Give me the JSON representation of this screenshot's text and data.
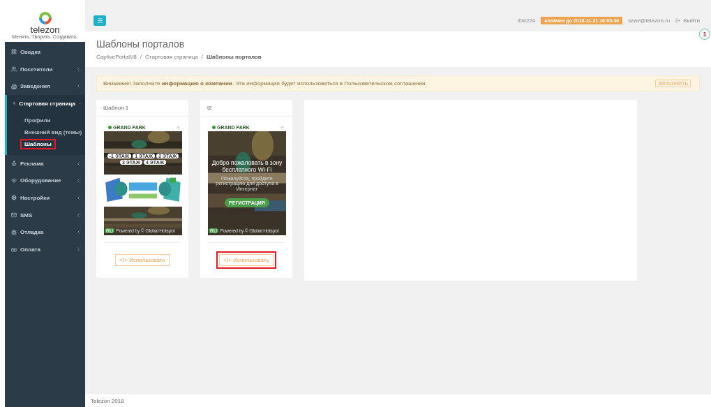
{
  "logo": {
    "name": "telezon",
    "tagline": "Менять. Творить. Создавать."
  },
  "topbar": {
    "account_id": "ID#224",
    "paid_until": "оплачен до 2018-11-21 16:05:46",
    "email": "seav@telezon.ru",
    "logout": "Выйти",
    "notification_count": "1"
  },
  "sidebar": {
    "items": [
      {
        "label": "Сводка",
        "has_arrow": false,
        "expanded": false
      },
      {
        "label": "Посетители",
        "has_arrow": true,
        "expanded": false
      },
      {
        "label": "Заведения",
        "has_arrow": true,
        "expanded": false
      },
      {
        "label": "Стартовая страница",
        "has_arrow": true,
        "expanded": true,
        "children": [
          {
            "label": "Профили",
            "selected": false,
            "highlighted": false
          },
          {
            "label": "Внешний вид (темы)",
            "selected": false,
            "highlighted": false
          },
          {
            "label": "Шаблоны",
            "selected": true,
            "highlighted": true
          }
        ]
      },
      {
        "label": "Реклама",
        "has_arrow": true,
        "expanded": false
      },
      {
        "label": "Оборудование",
        "has_arrow": true,
        "expanded": false
      },
      {
        "label": "Настройки",
        "has_arrow": true,
        "expanded": false
      },
      {
        "label": "SMS",
        "has_arrow": true,
        "expanded": false
      },
      {
        "label": "Отладка",
        "has_arrow": true,
        "expanded": false
      },
      {
        "label": "Оплата",
        "has_arrow": true,
        "expanded": false
      }
    ]
  },
  "page": {
    "title": "Шаблоны порталов",
    "breadcrumb_separators": [
      "/",
      "/"
    ],
    "breadcrumbs": [
      {
        "label": "CaptivePortalV8",
        "current": false
      },
      {
        "label": "Стартовая страница",
        "current": false
      },
      {
        "label": "Шаблоны порталов",
        "current": true
      }
    ]
  },
  "alert": {
    "text": "Внимание! Заполните **информацию о компании**. Эта информация будет использоваться в Пользовательском соглашении.",
    "button": "ЗАПОЛНИТЬ"
  },
  "templates": [
    {
      "title": "Шаблон 1",
      "kind": "map",
      "preview": {
        "logo": "GRAND PARK",
        "floors": [
          "-1 ЭТАЖ",
          "1 ЭТАЖ",
          "2 ЭТАЖ",
          "3 ЭТАЖ",
          "4 ЭТАЖ"
        ],
        "language": "RU",
        "powered": "Powered by © Global Hotspot"
      },
      "button": "</> Использовать",
      "highlighted": false
    },
    {
      "title": "t2",
      "kind": "welcome",
      "preview": {
        "logo": "GRAND PARK",
        "headline": "Добро пожаловать в зону бесплатного Wi-Fi",
        "subtext": "Пожалуйста, пройдите регистрацию для доступа в Интернет",
        "action": "РЕГИСТРАЦИЯ",
        "language": "RU",
        "powered": "Powered by © Global Hotspot"
      },
      "button": "</> Использовать",
      "highlighted": true
    }
  ],
  "footer": "Telezon 2018"
}
